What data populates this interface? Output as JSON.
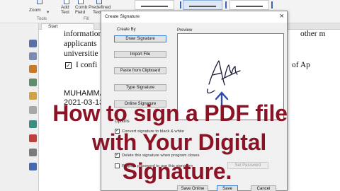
{
  "ribbon": {
    "zoom_label": "Zoom",
    "add_text_line1": "Add",
    "add_text_line2": "Text",
    "comb_field_line1": "Comb",
    "comb_field_line2": "Field",
    "predefined_line1": "Predefined",
    "predefined_line2": "Text",
    "group_tools": "Tools",
    "group_fill": "Fill"
  },
  "tabs": {
    "start": "Start"
  },
  "document": {
    "line1": "information",
    "line1_right": "other m",
    "line2": "applicants",
    "line3": "universitie",
    "line4_prefix": "I confi",
    "line4_right": "of Ap",
    "name": "MUHAMMA",
    "date": "2021-03-13",
    "check_mark": "✓"
  },
  "dialog": {
    "title": "Create Signature",
    "close": "×",
    "create_by": "Create By",
    "preview_label": "Preview",
    "buttons": {
      "draw": "Draw Signature",
      "import": "Import File",
      "paste": "Paste from Clipboard",
      "type": "Type Signature",
      "online": "Online Signature",
      "set_password": "Set Password",
      "save_online": "Save Online",
      "save": "Save",
      "cancel": "Cancel"
    },
    "options_label": "Options",
    "options": {
      "convert": "Convert signature to black & white",
      "delete": "Delete this signature when program closes",
      "require_password": "Require password to use this signature"
    },
    "check_mark": "✓"
  },
  "caption": {
    "line1": "How to sign a PDF file",
    "line2": "with Your Digital",
    "line3": "Signature."
  },
  "colors": {
    "caption": "#8a1426",
    "arrow": "#2f4aa7",
    "accent": "#3c7fd6"
  },
  "icons": [
    "search-icon",
    "add-text-icon",
    "comb-field-icon",
    "predefined-text-icon",
    "pen-arrow-icon",
    "bookmark-icon",
    "page-icon",
    "layers-icon",
    "comment-icon",
    "attachment-icon",
    "link-icon",
    "signature-icon",
    "close-icon"
  ]
}
